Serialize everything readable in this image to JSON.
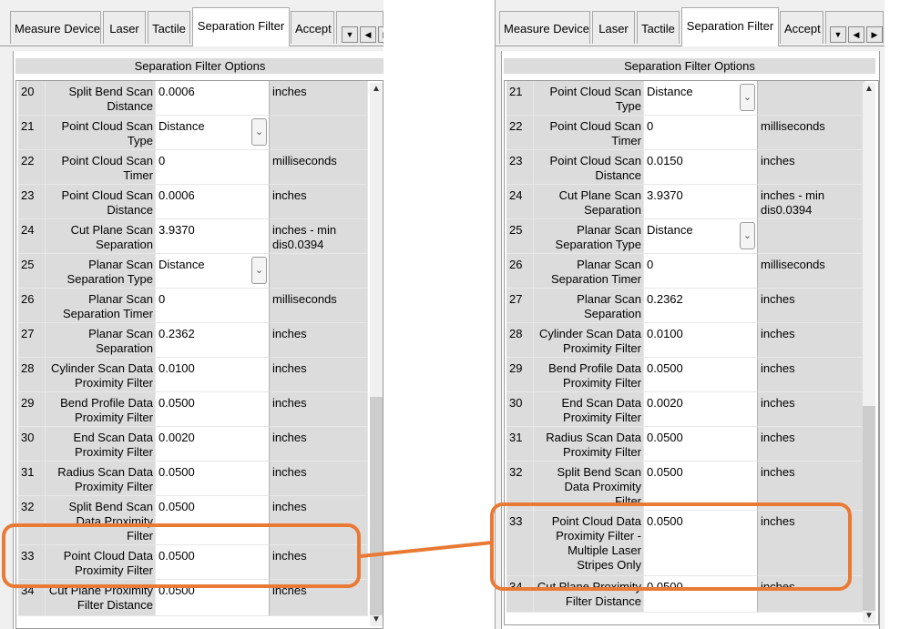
{
  "tabs": [
    "Measure Device",
    "Laser",
    "Tactile",
    "Separation Filter",
    "Accept"
  ],
  "active_tab": "Separation Filter",
  "section_title": "Separation Filter Options",
  "nav_icons": [
    "tab-more-icon",
    "scroll-left-icon",
    "scroll-right-icon"
  ],
  "highlight_color": "#e97a35",
  "left_panel": {
    "rows": [
      {
        "num": "20",
        "label": "Split Bend Scan Distance",
        "value": "0.0006",
        "unit": "inches"
      },
      {
        "num": "21",
        "label": "Point Cloud Scan Type",
        "value": "Distance",
        "unit": ""
      },
      {
        "num": "22",
        "label": "Point Cloud Scan Timer",
        "value": "0",
        "unit": "milliseconds"
      },
      {
        "num": "23",
        "label": "Point Cloud Scan Distance",
        "value": "0.0006",
        "unit": "inches"
      },
      {
        "num": "24",
        "label": "Cut Plane Scan Separation Distance",
        "value": "3.9370",
        "unit": "inches - min dis0.0394"
      },
      {
        "num": "25",
        "label": "Planar Scan Separation Type",
        "value": "Distance",
        "unit": ""
      },
      {
        "num": "26",
        "label": "Planar Scan Separation Timer",
        "value": "0",
        "unit": "milliseconds"
      },
      {
        "num": "27",
        "label": "Planar Scan Separation Distance",
        "value": "0.2362",
        "unit": "inches"
      },
      {
        "num": "28",
        "label": "Cylinder Scan Data Proximity Filter",
        "value": "0.0100",
        "unit": "inches"
      },
      {
        "num": "29",
        "label": "Bend Profile Data Proximity Filter",
        "value": "0.0500",
        "unit": "inches"
      },
      {
        "num": "30",
        "label": "End Scan Data Proximity Filter",
        "value": "0.0020",
        "unit": "inches"
      },
      {
        "num": "31",
        "label": "Radius Scan Data Proximity Filter",
        "value": "0.0500",
        "unit": "inches"
      },
      {
        "num": "32",
        "label": "Split Bend Scan Data Proximity Filter",
        "value": "0.0500",
        "unit": "inches"
      },
      {
        "num": "33",
        "label": "Point Cloud Data Proximity Filter",
        "value": "0.0500",
        "unit": "inches"
      },
      {
        "num": "34",
        "label": "Cut Plane Proximity Filter Distance",
        "value": "0.0500",
        "unit": "inches"
      }
    ]
  },
  "right_panel": {
    "rows": [
      {
        "num": "21",
        "label": "Point Cloud Scan Type",
        "value": "Distance",
        "unit": ""
      },
      {
        "num": "22",
        "label": "Point Cloud Scan Timer",
        "value": "0",
        "unit": "milliseconds"
      },
      {
        "num": "23",
        "label": "Point Cloud Scan Distance",
        "value": "0.0150",
        "unit": "inches"
      },
      {
        "num": "24",
        "label": "Cut Plane Scan Separation Distance",
        "value": "3.9370",
        "unit": "inches - min dis0.0394"
      },
      {
        "num": "25",
        "label": "Planar Scan Separation Type",
        "value": "Distance",
        "unit": ""
      },
      {
        "num": "26",
        "label": "Planar Scan Separation Timer",
        "value": "0",
        "unit": "milliseconds"
      },
      {
        "num": "27",
        "label": "Planar Scan Separation Distance",
        "value": "0.2362",
        "unit": "inches"
      },
      {
        "num": "28",
        "label": "Cylinder Scan Data Proximity Filter",
        "value": "0.0100",
        "unit": "inches"
      },
      {
        "num": "29",
        "label": "Bend Profile Data Proximity Filter",
        "value": "0.0500",
        "unit": "inches"
      },
      {
        "num": "30",
        "label": "End Scan Data Proximity Filter",
        "value": "0.0020",
        "unit": "inches"
      },
      {
        "num": "31",
        "label": "Radius Scan Data Proximity Filter",
        "value": "0.0500",
        "unit": "inches"
      },
      {
        "num": "32",
        "label": "Split Bend Scan Data Proximity Filter",
        "value": "0.0500",
        "unit": "inches"
      },
      {
        "num": "33",
        "label": "Point Cloud Data Proximity Filter - Multiple Laser Stripes Only",
        "value": "0.0500",
        "unit": "inches"
      },
      {
        "num": "34",
        "label": "Cut Plane Proximity Filter Distance",
        "value": "0.0500",
        "unit": "inches"
      }
    ]
  }
}
